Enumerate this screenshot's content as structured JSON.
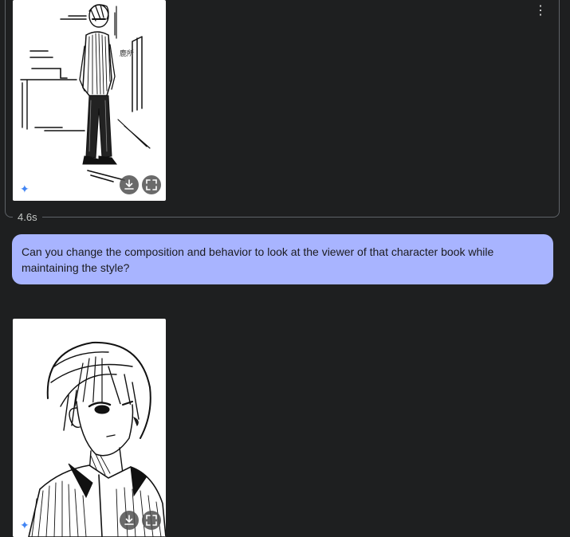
{
  "previous_response": {
    "more_icon": "more-vert-icon",
    "timing": "4.6s",
    "image": {
      "sparkle_icon": "sparkle-icon",
      "download_icon": "download-icon",
      "fullscreen_icon": "fullscreen-icon"
    }
  },
  "user_message": {
    "text": "Can you change the composition and behavior to look at the viewer of that character book while maintaining the style?"
  },
  "response": {
    "image": {
      "sparkle_icon": "sparkle-icon",
      "download_icon": "download-icon",
      "fullscreen_icon": "fullscreen-icon"
    }
  },
  "colors": {
    "background": "#1e1f20",
    "user_bubble": "#a8b4ff",
    "sparkle": "#4285f4"
  }
}
